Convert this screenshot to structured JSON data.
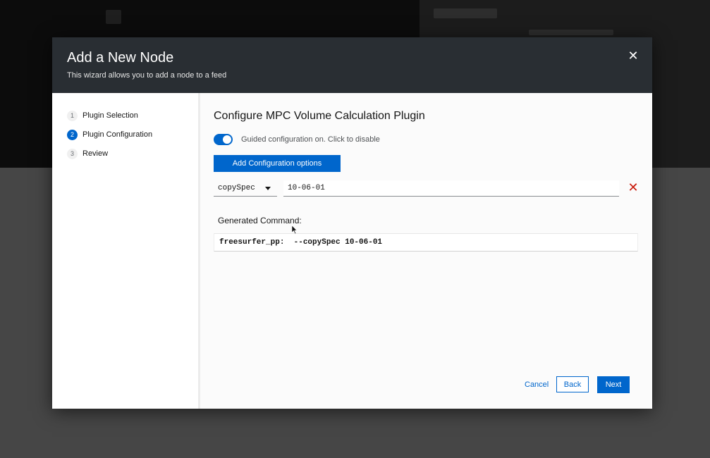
{
  "modal": {
    "title": "Add a New Node",
    "description": "This wizard allows you to add a node to a feed",
    "close_icon": "close-icon"
  },
  "wizard_nav": {
    "steps": [
      {
        "number": "1",
        "label": "Plugin Selection",
        "current": false
      },
      {
        "number": "2",
        "label": "Plugin Configuration",
        "current": true
      },
      {
        "number": "3",
        "label": "Review",
        "current": false
      }
    ]
  },
  "main": {
    "title": "Configure MPC Volume Calculation Plugin",
    "guided_toggle_label": "Guided configuration on. Click to disable",
    "guided_toggle_on": true,
    "add_button_label": "Add Configuration options",
    "param": {
      "selected": "copySpec",
      "value": "10-06-01",
      "remove_icon": "remove-x-icon"
    },
    "generated_label": "Generated Command:",
    "generated_command": "freesurfer_pp:  --copySpec 10-06-01"
  },
  "footer": {
    "cancel_label": "Cancel",
    "back_label": "Back",
    "next_label": "Next"
  },
  "colors": {
    "accent": "#0066cc",
    "header_bg": "#292e33",
    "danger": "#c9190b"
  }
}
